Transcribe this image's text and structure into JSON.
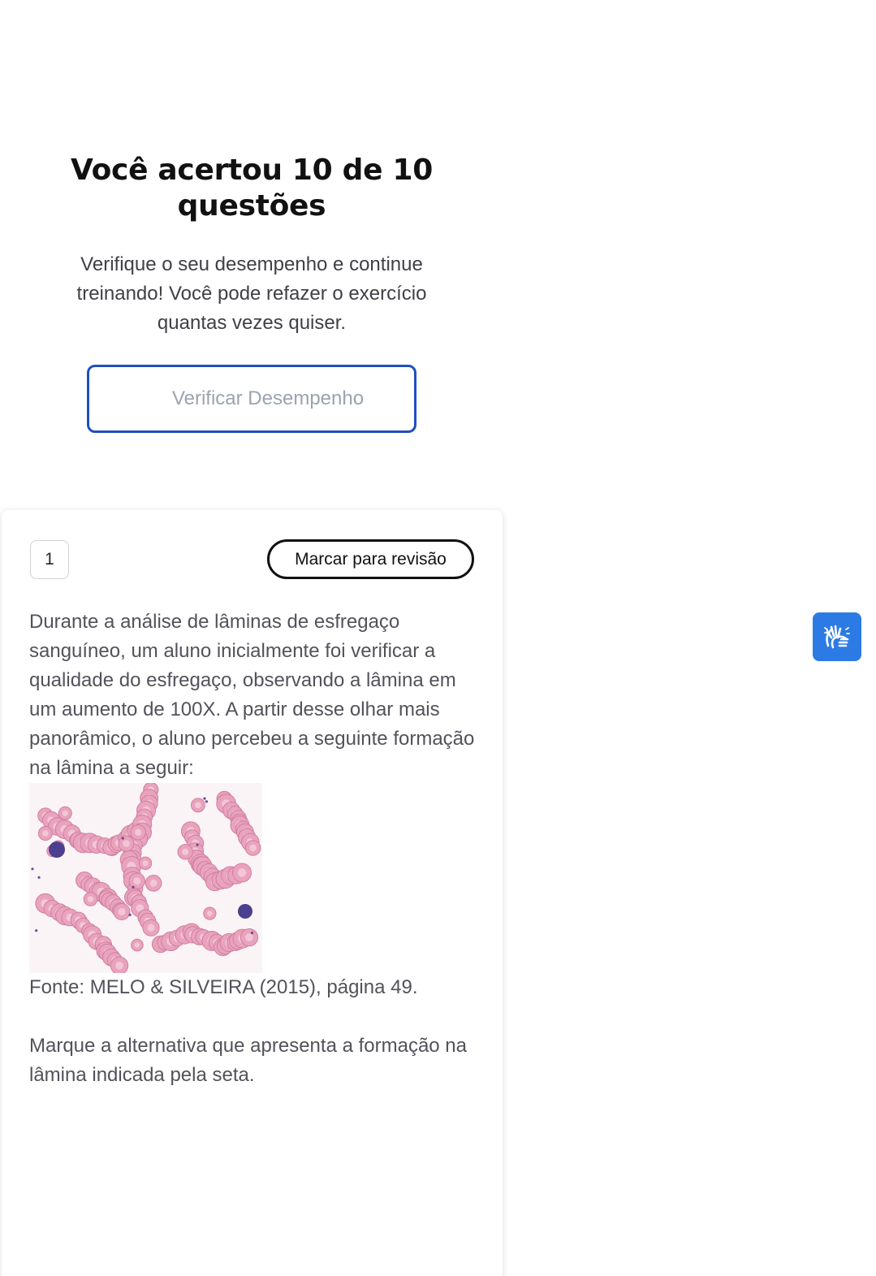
{
  "result": {
    "title": "Você acertou 10 de 10 questões",
    "subtitle": "Verifique o seu desempenho e continue treinando! Você pode refazer o exercício quantas vezes quiser.",
    "check_button_label": "Verificar Desempenho"
  },
  "question": {
    "number": "1",
    "review_button_label": "Marcar para revisão",
    "statement": "Durante a análise de lâminas de esfregaço sanguíneo, um aluno inicialmente foi verificar a qualidade do esfregaço, observando a lâmina em um aumento de 100X. A partir desse olhar mais panorâmico, o aluno percebeu a seguinte formação na lâmina a seguir:",
    "source": "Fonte: MELO & SILVEIRA (2015), página 49.",
    "prompt": "Marque a alternativa que apresenta  a formação na lâmina indicada pela seta."
  },
  "icons": {
    "accessibility": "sign-language-hands-icon"
  },
  "colors": {
    "primary_blue": "#1f4fbf",
    "widget_blue": "#2c7be5",
    "muted_text": "#9ca3af",
    "body_text": "#52525b"
  }
}
